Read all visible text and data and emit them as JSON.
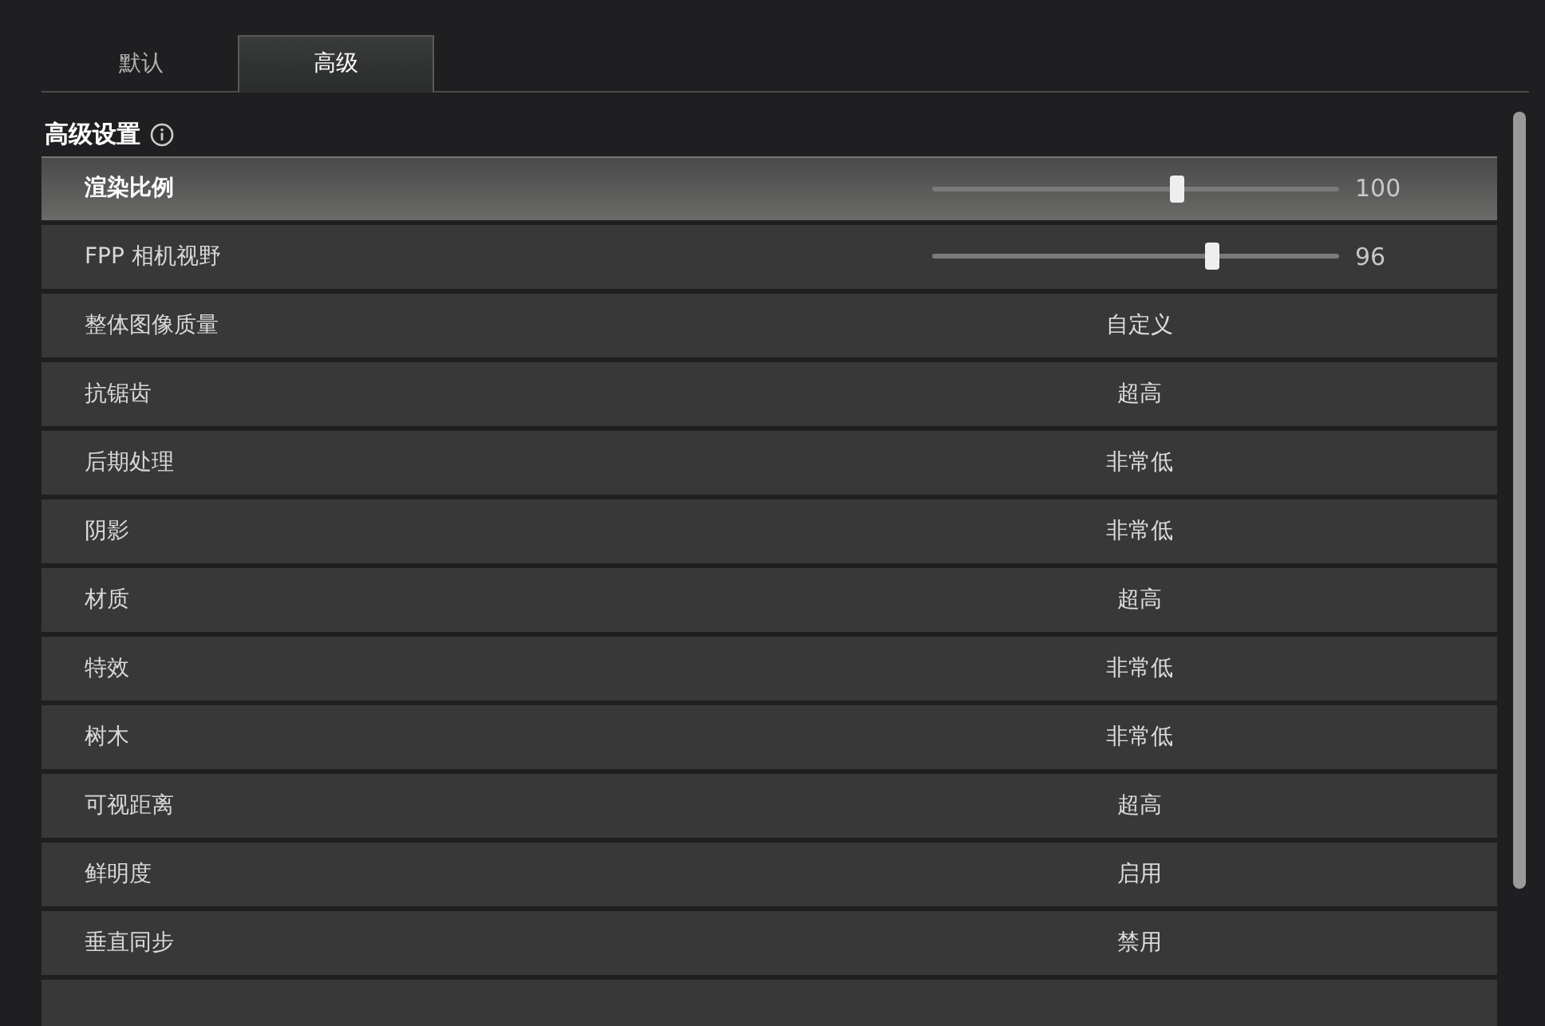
{
  "tabs": [
    {
      "label": "默认",
      "selected": false
    },
    {
      "label": "高级",
      "selected": true
    }
  ],
  "section": {
    "title": "高级设置"
  },
  "rows": [
    {
      "kind": "slider",
      "label": "渲染比例",
      "level": 0.6,
      "reading": "100",
      "selected": true
    },
    {
      "kind": "slider",
      "label": "FPP 相机视野",
      "level": 0.69,
      "reading": "96",
      "selected": false
    },
    {
      "kind": "option",
      "label": "整体图像质量",
      "value": "自定义",
      "selected": false
    },
    {
      "kind": "option",
      "label": "抗锯齿",
      "value": "超高",
      "selected": false
    },
    {
      "kind": "option",
      "label": "后期处理",
      "value": "非常低",
      "selected": false
    },
    {
      "kind": "option",
      "label": "阴影",
      "value": "非常低",
      "selected": false
    },
    {
      "kind": "option",
      "label": "材质",
      "value": "超高",
      "selected": false
    },
    {
      "kind": "option",
      "label": "特效",
      "value": "非常低",
      "selected": false
    },
    {
      "kind": "option",
      "label": "树木",
      "value": "非常低",
      "selected": false
    },
    {
      "kind": "option",
      "label": "可视距离",
      "value": "超高",
      "selected": false
    },
    {
      "kind": "option",
      "label": "鲜明度",
      "value": "启用",
      "selected": false
    },
    {
      "kind": "option",
      "label": "垂直同步",
      "value": "禁用",
      "selected": false
    }
  ]
}
